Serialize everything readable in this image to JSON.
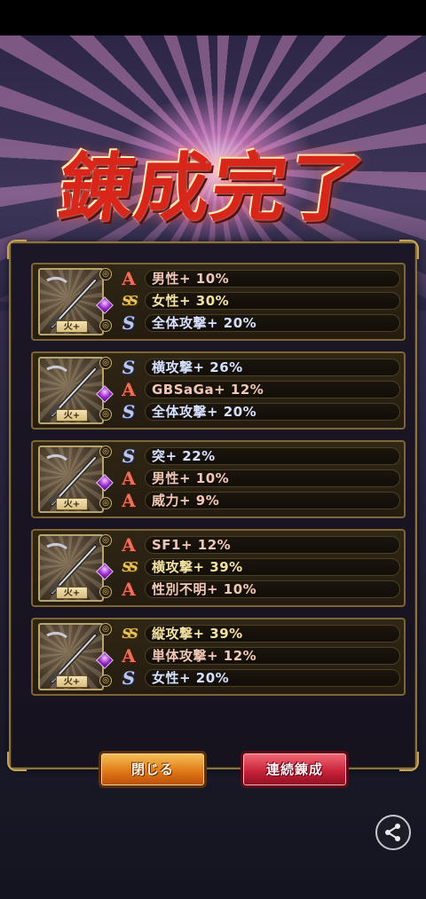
{
  "title": "錬成完了",
  "results": [
    {
      "weapon_label": "火+",
      "stats": [
        {
          "rank": "A",
          "rank_glyph": "A",
          "text": "男性+ 10%"
        },
        {
          "rank": "SS",
          "rank_glyph": "SS",
          "text": "女性+ 30%"
        },
        {
          "rank": "S",
          "rank_glyph": "S",
          "text": "全体攻撃+ 20%"
        }
      ]
    },
    {
      "weapon_label": "火+",
      "stats": [
        {
          "rank": "S",
          "rank_glyph": "S",
          "text": "横攻撃+ 26%"
        },
        {
          "rank": "A",
          "rank_glyph": "A",
          "text": "GBSaGa+ 12%"
        },
        {
          "rank": "S",
          "rank_glyph": "S",
          "text": "全体攻撃+ 20%"
        }
      ]
    },
    {
      "weapon_label": "火+",
      "stats": [
        {
          "rank": "S",
          "rank_glyph": "S",
          "text": "突+ 22%"
        },
        {
          "rank": "A",
          "rank_glyph": "A",
          "text": "男性+ 10%"
        },
        {
          "rank": "A",
          "rank_glyph": "A",
          "text": "威力+ 9%"
        }
      ]
    },
    {
      "weapon_label": "火+",
      "stats": [
        {
          "rank": "A",
          "rank_glyph": "A",
          "text": "SF1+ 12%"
        },
        {
          "rank": "SS",
          "rank_glyph": "SS",
          "text": "横攻撃+ 39%"
        },
        {
          "rank": "A",
          "rank_glyph": "A",
          "text": "性別不明+ 10%"
        }
      ]
    },
    {
      "weapon_label": "火+",
      "stats": [
        {
          "rank": "SS",
          "rank_glyph": "SS",
          "text": "縦攻撃+ 39%"
        },
        {
          "rank": "A",
          "rank_glyph": "A",
          "text": "単体攻撃+ 12%"
        },
        {
          "rank": "S",
          "rank_glyph": "S",
          "text": "女性+ 20%"
        }
      ]
    }
  ],
  "buttons": {
    "close_label": "閉じる",
    "continue_label": "連続錬成"
  },
  "icons": {
    "share": "share-icon",
    "weapon": "sword-icon",
    "gem": "purple-gem-icon"
  },
  "colors": {
    "rank_A": "#e8735c",
    "rank_S": "#b9c6ee",
    "rank_SS": "#e8c45c",
    "close_button": "#e07a18",
    "continue_button": "#c9233b",
    "title": "#d8261a"
  }
}
